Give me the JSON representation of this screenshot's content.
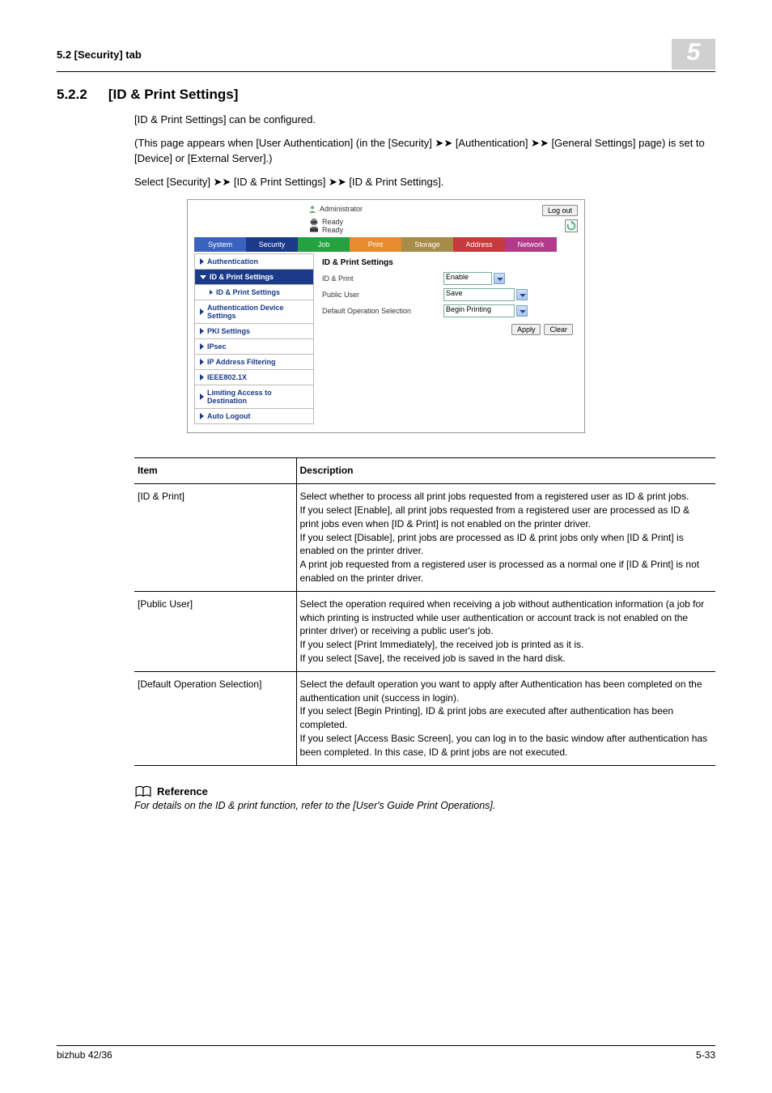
{
  "header": {
    "left": "5.2        [Security] tab",
    "chapter": "5"
  },
  "h2": {
    "num": "5.2.2",
    "title": "[ID & Print Settings]"
  },
  "para": {
    "p1": "[ID & Print Settings] can be configured.",
    "p2": "(This page appears when [User Authentication] (in the [Security] ➤➤ [Authentication] ➤➤ [General Settings] page) is set to [Device] or [External Server].)",
    "p3": "Select [Security] ➤➤ [ID & Print Settings] ➤➤ [ID & Print Settings]."
  },
  "shot": {
    "admin": "Administrator",
    "logout": "Log out",
    "ready1": "Ready",
    "ready2": "Ready",
    "tabs": [
      "System",
      "Security",
      "Job",
      "Print",
      "Storage",
      "Address",
      "Network"
    ],
    "side": {
      "auth": "Authentication",
      "idp_group": "ID & Print Settings",
      "idp_item": "ID & Print Settings",
      "authdev": "Authentication Device Settings",
      "pki": "PKI Settings",
      "ipsec": "IPsec",
      "ipfilter": "IP Address Filtering",
      "ieee": "IEEE802.1X",
      "limit": "Limiting Access to Destination",
      "autologout": "Auto Logout"
    },
    "content": {
      "title": "ID & Print Settings",
      "row1_label": "ID & Print",
      "row1_value": "Enable",
      "row2_label": "Public User",
      "row2_value": "Save",
      "row3_label": "Default Operation Selection",
      "row3_value": "Begin Printing",
      "apply": "Apply",
      "clear": "Clear"
    }
  },
  "table": {
    "h_item": "Item",
    "h_desc": "Description",
    "rows": [
      {
        "item": "[ID & Print]",
        "desc": "Select whether to process all print jobs requested from a registered user as ID & print jobs.\nIf you select [Enable], all print jobs requested from a registered user are processed as ID & print jobs even when [ID & Print] is not enabled on the printer driver.\nIf you select [Disable], print jobs are processed as ID & print jobs only when [ID & Print] is enabled on the printer driver.\nA print job requested from a registered user is processed as a normal one if [ID & Print] is not enabled on the printer driver."
      },
      {
        "item": "[Public User]",
        "desc": "Select the operation required when receiving a job without authentication information (a job for which printing is instructed while user authentication or account track is not enabled on the printer driver) or receiving a public user's job.\nIf you select [Print Immediately], the received job is printed as it is.\nIf you select [Save], the received job is saved in the hard disk."
      },
      {
        "item": "[Default Operation Selection]",
        "desc": "Select the default operation you want to apply after Authentication has been completed on the authentication unit (success in login).\nIf you select [Begin Printing], ID & print jobs are executed after authentication has been completed.\nIf you select [Access Basic Screen], you can log in to the basic window after authentication has been completed. In this case, ID & print jobs are not executed."
      }
    ]
  },
  "ref": {
    "title": "Reference",
    "body": "For details on the ID & print function, refer to the [User's Guide Print Operations]."
  },
  "footer": {
    "left": "bizhub 42/36",
    "right": "5-33"
  }
}
